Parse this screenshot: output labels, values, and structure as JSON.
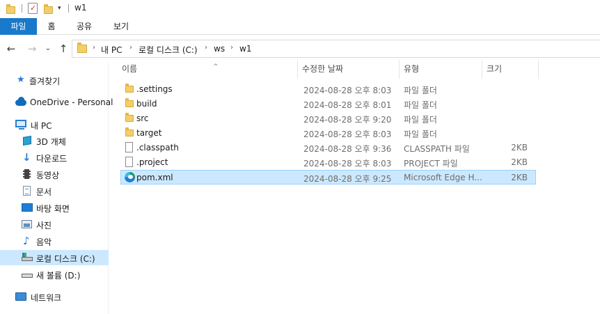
{
  "window": {
    "title": "w1"
  },
  "ribbon": {
    "tabs": [
      {
        "label": "파일"
      },
      {
        "label": "홈"
      },
      {
        "label": "공유"
      },
      {
        "label": "보기"
      }
    ]
  },
  "nav": {
    "back_icon": "back-arrow-icon",
    "forward_icon": "forward-arrow-icon",
    "recent_icon": "chevron-down-icon",
    "up_icon": "up-arrow-icon"
  },
  "address": {
    "crumbs": [
      "내 PC",
      "로컬 디스크 (C:)",
      "ws",
      "w1"
    ]
  },
  "sidebar": {
    "items": [
      {
        "label": "즐겨찾기",
        "icon": "star-icon"
      },
      {
        "label": "OneDrive - Personal",
        "icon": "cloud-icon"
      },
      {
        "label": "내 PC",
        "icon": "pc-icon"
      },
      {
        "label": "3D 개체",
        "icon": "cube-icon"
      },
      {
        "label": "다운로드",
        "icon": "download-icon"
      },
      {
        "label": "동영상",
        "icon": "video-icon"
      },
      {
        "label": "문서",
        "icon": "document-icon"
      },
      {
        "label": "바탕 화면",
        "icon": "desktop-icon"
      },
      {
        "label": "사진",
        "icon": "picture-icon"
      },
      {
        "label": "음악",
        "icon": "music-icon"
      },
      {
        "label": "로컬 디스크 (C:)",
        "icon": "drive-icon",
        "selected": true
      },
      {
        "label": "새 볼륨 (D:)",
        "icon": "drive-icon"
      },
      {
        "label": "네트워크",
        "icon": "network-icon"
      }
    ]
  },
  "columns": {
    "name": "이름",
    "date": "수정한 날짜",
    "type": "유형",
    "size": "크기"
  },
  "files": [
    {
      "name": ".settings",
      "date": "2024-08-28 오후 8:03",
      "type": "파일 폴더",
      "size": "",
      "icon": "folder-icon"
    },
    {
      "name": "build",
      "date": "2024-08-28 오후 8:01",
      "type": "파일 폴더",
      "size": "",
      "icon": "folder-icon"
    },
    {
      "name": "src",
      "date": "2024-08-28 오후 9:20",
      "type": "파일 폴더",
      "size": "",
      "icon": "folder-icon"
    },
    {
      "name": "target",
      "date": "2024-08-28 오후 8:03",
      "type": "파일 폴더",
      "size": "",
      "icon": "folder-icon"
    },
    {
      "name": ".classpath",
      "date": "2024-08-28 오후 9:36",
      "type": "CLASSPATH 파일",
      "size": "2KB",
      "icon": "file-icon"
    },
    {
      "name": ".project",
      "date": "2024-08-28 오후 8:03",
      "type": "PROJECT 파일",
      "size": "2KB",
      "icon": "file-icon"
    },
    {
      "name": "pom.xml",
      "date": "2024-08-28 오후 9:25",
      "type": "Microsoft Edge H...",
      "size": "2KB",
      "icon": "edge-icon",
      "selected": true
    }
  ],
  "colors": {
    "accent": "#1979ca",
    "selection": "#cce8ff",
    "selection_border": "#99d1ff"
  }
}
